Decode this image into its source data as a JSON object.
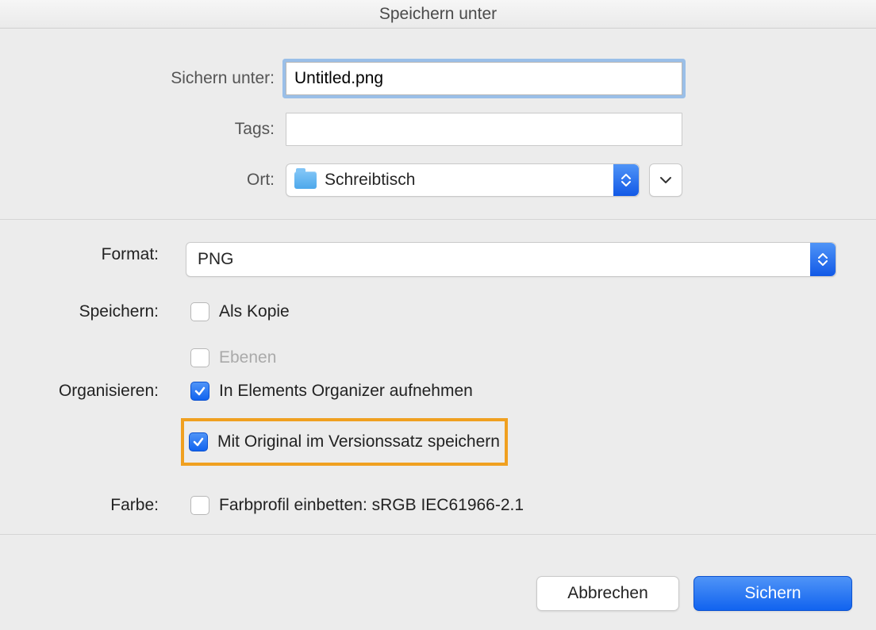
{
  "title": "Speichern unter",
  "labels": {
    "save_as": "Sichern unter:",
    "tags": "Tags:",
    "location_label": "Ort:",
    "format": "Format:",
    "save_section": "Speichern:",
    "organize": "Organisieren:",
    "color": "Farbe:"
  },
  "filename": "Untitled.png",
  "tags_value": "",
  "location": "Schreibtisch",
  "format_value": "PNG",
  "checkboxes": {
    "as_copy": {
      "label": "Als Kopie",
      "checked": false,
      "enabled": true
    },
    "layers": {
      "label": "Ebenen",
      "checked": false,
      "enabled": false
    },
    "include_organizer": {
      "label": "In Elements Organizer aufnehmen",
      "checked": true,
      "enabled": true
    },
    "version_set": {
      "label": "Mit Original im Versionssatz speichern",
      "checked": true,
      "enabled": true
    },
    "embed_profile": {
      "label": "Farbprofil einbetten: sRGB IEC61966-2.1",
      "checked": false,
      "enabled": true
    }
  },
  "buttons": {
    "cancel": "Abbrechen",
    "save": "Sichern"
  }
}
